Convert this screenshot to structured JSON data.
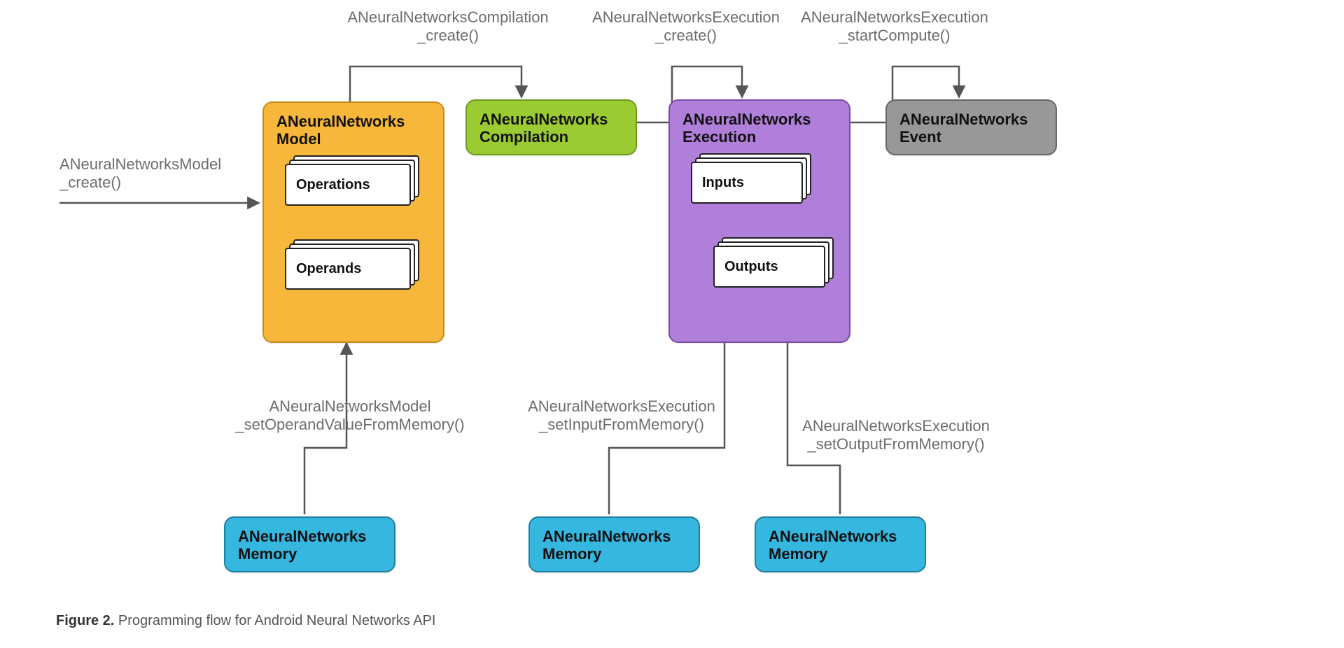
{
  "caption": {
    "figure": "Figure 2.",
    "text": "Programming flow for Android Neural Networks API"
  },
  "arrow_labels": {
    "model_create": "ANeuralNetworksModel\n_create()",
    "compilation_create": "ANeuralNetworksCompilation\n_create()",
    "execution_create": "ANeuralNetworksExecution\n_create()",
    "execution_start": "ANeuralNetworksExecution\n_startCompute()",
    "set_operand_from_mem": "ANeuralNetworksModel\n_setOperandValueFromMemory()",
    "set_input_from_mem": "ANeuralNetworksExecution\n_setInputFromMemory()",
    "set_output_from_mem": "ANeuralNetworksExecution\n_setOutputFromMemory()"
  },
  "nodes": {
    "model": {
      "title_l1": "ANeuralNetworks",
      "title_l2": "Model",
      "color": "#f7b73b",
      "border": "#c58a1e"
    },
    "compilation": {
      "title_l1": "ANeuralNetworks",
      "title_l2": "Compilation",
      "color": "#9acb32",
      "border": "#6f9a20"
    },
    "execution": {
      "title_l1": "ANeuralNetworks",
      "title_l2": "Execution",
      "color": "#b07fd9",
      "border": "#7a4ba6"
    },
    "event": {
      "title_l1": "ANeuralNetworks",
      "title_l2": "Event",
      "color": "#989898",
      "border": "#666666"
    },
    "memory1": {
      "title_l1": "ANeuralNetworks",
      "title_l2": "Memory",
      "color": "#36b7e0",
      "border": "#1f7fa0"
    },
    "memory2": {
      "title_l1": "ANeuralNetworks",
      "title_l2": "Memory",
      "color": "#36b7e0",
      "border": "#1f7fa0"
    },
    "memory3": {
      "title_l1": "ANeuralNetworks",
      "title_l2": "Memory",
      "color": "#36b7e0",
      "border": "#1f7fa0"
    }
  },
  "cards": {
    "operations": "Operations",
    "operands": "Operands",
    "inputs": "Inputs",
    "outputs": "Outputs"
  }
}
